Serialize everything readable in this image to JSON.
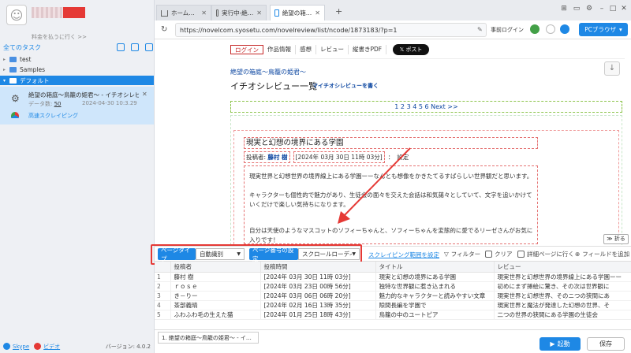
{
  "sidebar": {
    "pay_link": "料金を払うに行く >>",
    "tasks_header": "全てのタスク",
    "tree": [
      {
        "label": "test"
      },
      {
        "label": "Samples"
      },
      {
        "label": "デフォルト"
      }
    ],
    "task": {
      "title": "絶望の箱庭～鳥籠の姫君～ - イチオシレビ…",
      "data_label": "データ数:",
      "data_count": "50",
      "date": "2024-04-30 10:3.29",
      "fast_scrape": "高速スクレイピング"
    },
    "footer": {
      "skype": "Skype",
      "video": "ビデオ",
      "version": "バージョン: 4.0.2"
    }
  },
  "tabs": [
    {
      "label": "ホーム…"
    },
    {
      "label": "実行中-絶…"
    },
    {
      "label": "絶望の箱…"
    }
  ],
  "address": {
    "url": "https://novelcom.syosetu.com/novelreview/list/ncode/1873183/?p=1",
    "pre_login": "事前ログイン",
    "browser_label": "PCブラウザ"
  },
  "web": {
    "nav": [
      "ログイン",
      "作品情報",
      "感想",
      "レビュー",
      "縦書きPDF"
    ],
    "xpost": "ポスト",
    "novel_title": "絶望の箱庭～鳥籠の姫君～",
    "page_heading": "イチオシレビュー一覧",
    "write_review": "マイチオシレビューを書く",
    "pager": "1 2 3 4 5 6 Next >>",
    "review_title": "現実と幻想の境界にある学園",
    "poster_label": "投稿者:",
    "poster_name": "藤村 樹",
    "post_date": "[2024年 03月 30日 11時 03分]",
    "setting": "設定",
    "paragraphs": [
      "現実世界と幻想世界の境界線上にある学園ーーなんとも想像をかきたてるすばらしい世界観だと思います。",
      "キャラクターも個性的で魅力があり、生徒会の面々を交えた会話は和気藹々としていて、文字を追いかけていくだけで楽しい気持ちになります。",
      "自分は天使のようなマスコットのソフィーちゃんと、ソフィーちゃんを変態的に愛でるリーゼさんがお気に入りです！"
    ],
    "fold": "折る"
  },
  "toolbar": {
    "page_type_label": "ページタイプ",
    "page_type_value": "自動識別",
    "page_num_label": "ページ番号の設定",
    "page_num_value": "スクロールローディン",
    "scrape_range": "スクレイピング範囲を設定",
    "filter": "フィルター",
    "clear": "クリア",
    "detail": "詳細ページに行く",
    "add_field": "フィールドを追加"
  },
  "table": {
    "headers": [
      "投稿者",
      "投稿時間",
      "タイトル",
      "レビュー"
    ],
    "rows": [
      {
        "n": "1",
        "poster": "藤村 樹",
        "time": "[2024年 03月 30日 11時 03分]",
        "title": "現実と幻想の境界にある学園",
        "review": "現実世界と幻想世界の境界線上にある学園ーー"
      },
      {
        "n": "2",
        "poster": "ｒｏｓｅ",
        "time": "[2024年 03月 23日 00時 56分]",
        "title": "独特な世界観に惹き込まれる",
        "review": "初めにまず挿絵に驚き、その次は世界観に"
      },
      {
        "n": "3",
        "poster": "き－りー",
        "time": "[2024年 03月 06日 06時 20分]",
        "title": "魅力的なキャラクターと読みやすい文章",
        "review": "現実世界と幻想世界、そのニつの狭間にあ"
      },
      {
        "n": "4",
        "poster": "茶部義晴",
        "time": "[2024年 02月 16日 13時 35分]",
        "title": "隙間長編を学園で",
        "review": "現実世界と魔法が発達した幻想の世界、そ"
      },
      {
        "n": "5",
        "poster": "ふわふわ毛の生えた猫",
        "time": "[2024年 01月 25日 18時 43分]",
        "title": "鳥籠の中のユートピア",
        "review": "二つの世界の狭間にある学園の生徒会"
      }
    ]
  },
  "bottom": {
    "url_chip": "1. 絶望の箱庭～鳥籠の姫君～ - イ…",
    "start": "起動",
    "save": "保存"
  },
  "colors": {
    "accent": "#1e88e5",
    "highlight": "#e53935"
  }
}
